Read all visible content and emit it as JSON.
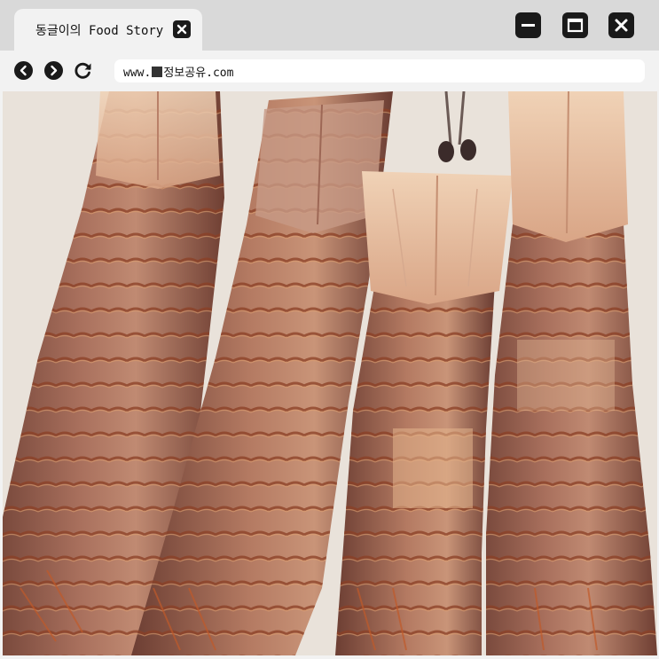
{
  "tab": {
    "title": "동글이의 Food Story",
    "close_icon": "close-icon"
  },
  "window_controls": [
    "minimize-icon",
    "maximize-icon",
    "close-icon"
  ],
  "toolbar": {
    "back_icon": "chevron-left-icon",
    "forward_icon": "chevron-right-icon",
    "reload_icon": "reload-icon",
    "url_prefix": "www.",
    "url_suffix": "정보공유.com"
  },
  "colors": {
    "chrome_bg": "#d9d9d9",
    "toolbar_bg": "#f2f2f2",
    "button_dark": "#1a1a1a"
  }
}
